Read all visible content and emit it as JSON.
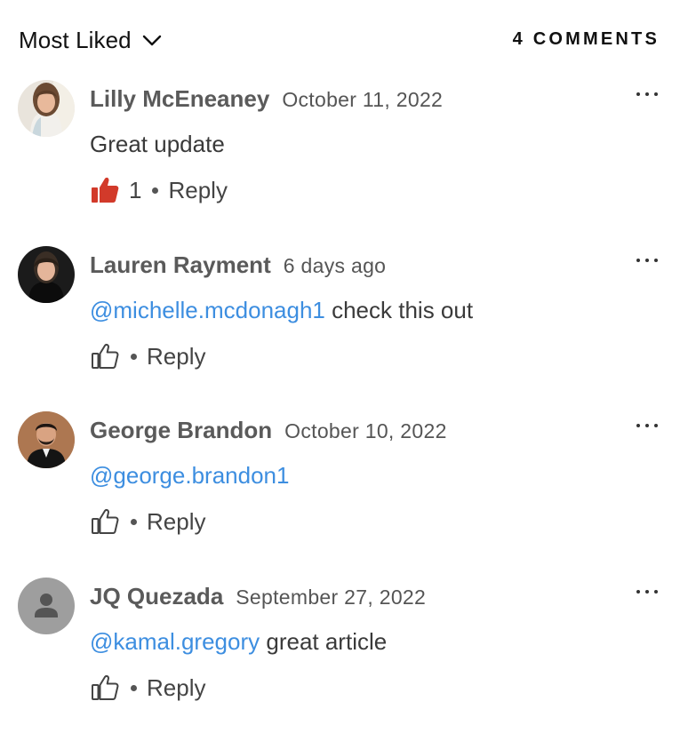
{
  "header": {
    "sort_label": "Most Liked",
    "comment_count": "4 COMMENTS"
  },
  "colors": {
    "mention": "#3d8ee0",
    "like_active": "#d23a2a"
  },
  "comments": [
    {
      "author": "Lilly McEneaney",
      "date": "October 11, 2022",
      "mention": "",
      "text": "Great update",
      "liked": true,
      "like_count": "1",
      "reply_label": "Reply"
    },
    {
      "author": "Lauren Rayment",
      "date": "6 days ago",
      "mention": "@michelle.mcdonagh1",
      "text": " check this out",
      "liked": false,
      "like_count": "",
      "reply_label": "Reply"
    },
    {
      "author": "George Brandon",
      "date": "October 10, 2022",
      "mention": "@george.brandon1",
      "text": "",
      "liked": false,
      "like_count": "",
      "reply_label": "Reply"
    },
    {
      "author": "JQ Quezada",
      "date": "September 27, 2022",
      "mention": "@kamal.gregory",
      "text": " great article",
      "liked": false,
      "like_count": "",
      "reply_label": "Reply"
    }
  ]
}
